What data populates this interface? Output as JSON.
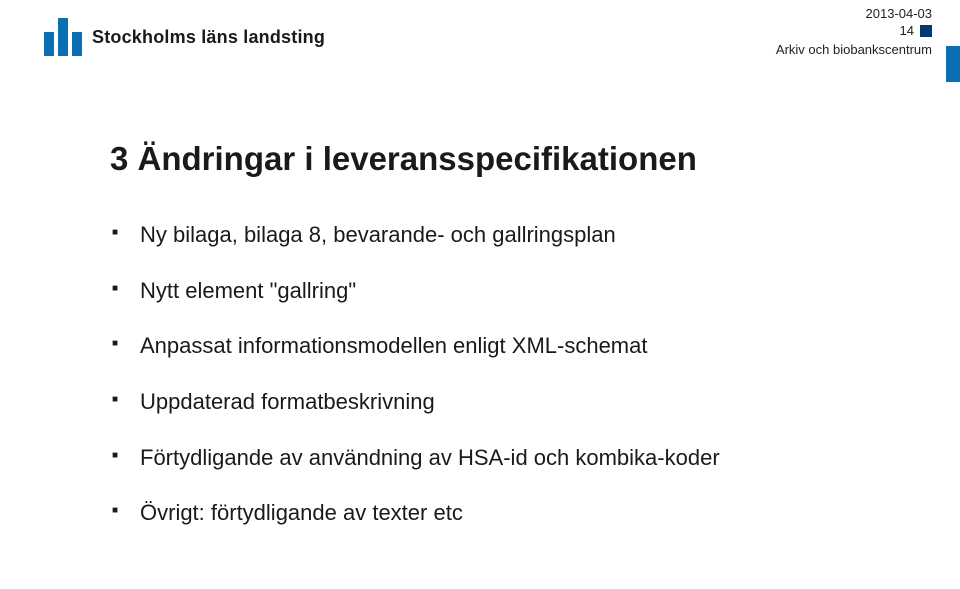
{
  "header": {
    "org_name": "Stockholms läns landsting",
    "date": "2013-04-03",
    "page_number": "14",
    "subtitle": "Arkiv och biobankscentrum"
  },
  "content": {
    "title": "3 Ändringar i leveransspecifikationen",
    "bullets": [
      "Ny bilaga, bilaga 8, bevarande- och gallringsplan",
      "Nytt element \"gallring\"",
      "Anpassat informationsmodellen enligt XML-schemat",
      "Uppdaterad formatbeskrivning",
      "Förtydligande av användning av HSA-id och kombika-koder",
      "Övrigt: förtydligande av texter etc"
    ]
  },
  "colors": {
    "brand_blue": "#0a6fb4",
    "dark_blue": "#003a70"
  }
}
